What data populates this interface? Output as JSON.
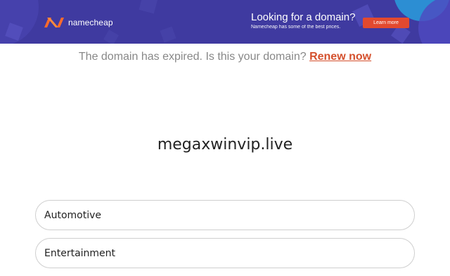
{
  "banner": {
    "brand_name": "namecheap",
    "title": "Looking for a domain?",
    "subtitle": "Namecheap has some of the best prices.",
    "button_label": "Learn more",
    "colors": {
      "background": "#3f3aa0",
      "button": "#e2492f"
    }
  },
  "notice": {
    "text": "The domain has expired. Is this your domain?",
    "link_label": "Renew now",
    "link_color": "#d4502d"
  },
  "domain_name": "megaxwinvip.live",
  "categories": [
    "Automotive",
    "Entertainment"
  ]
}
